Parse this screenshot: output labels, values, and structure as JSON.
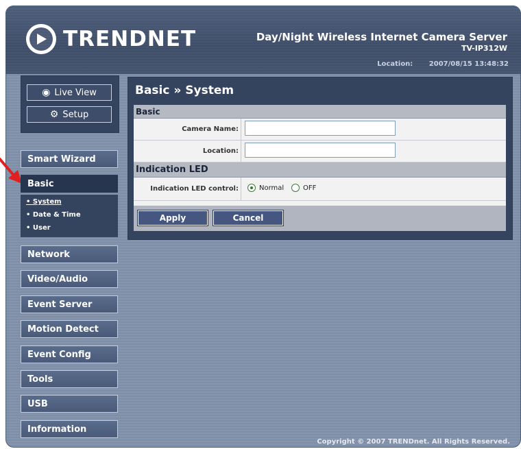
{
  "header": {
    "brand": "TRENDNET",
    "product_name": "Day/Night Wireless Internet Camera Server",
    "model": "TV-IP312W",
    "location_label": "Location:",
    "datetime": "2007/08/15 13:48:32"
  },
  "top_buttons": {
    "live_view": "Live View",
    "setup": "Setup"
  },
  "nav": {
    "smart_wizard": "Smart Wizard",
    "basic": "Basic",
    "basic_sub": [
      "System",
      "Date & Time",
      "User"
    ],
    "network": "Network",
    "video_audio": "Video/Audio",
    "event_server": "Event Server",
    "motion_detect": "Motion Detect",
    "event_config": "Event Config",
    "tools": "Tools",
    "usb": "USB",
    "information": "Information"
  },
  "content": {
    "title": "Basic » System",
    "section_basic": "Basic",
    "camera_name_label": "Camera Name:",
    "camera_name_value": "",
    "location_label": "Location:",
    "location_value": "",
    "section_led": "Indication LED",
    "led_control_label": "Indication LED control:",
    "led_option_normal": "Normal",
    "led_option_off": "OFF",
    "apply": "Apply",
    "cancel": "Cancel"
  },
  "footer": {
    "copyright": "Copyright © 2007 TRENDnet. All Rights Reserved."
  },
  "colors": {
    "header_bg": "#3e4d68",
    "nav_active": "#27354f",
    "arrow": "#e02020"
  }
}
